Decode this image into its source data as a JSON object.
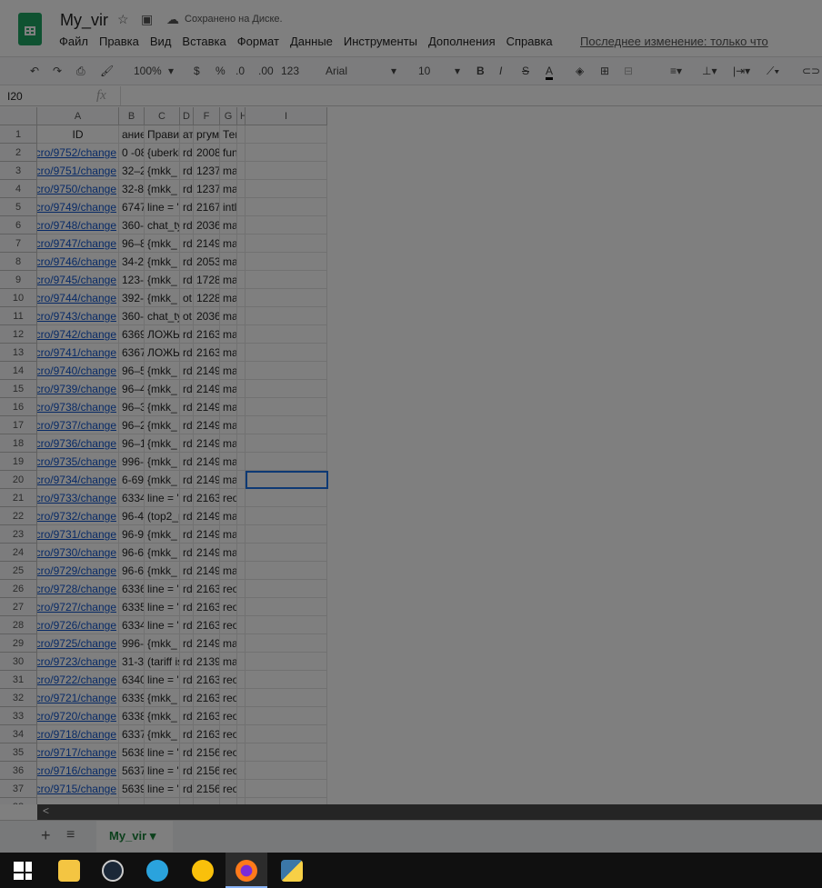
{
  "doc": {
    "title": "My_vir",
    "saved_status": "Сохранено на Диске.",
    "last_edit": "Последнее изменение: только что"
  },
  "menu": [
    "Файл",
    "Правка",
    "Вид",
    "Вставка",
    "Формат",
    "Данные",
    "Инструменты",
    "Дополнения",
    "Справка"
  ],
  "toolbar": {
    "zoom": "100%",
    "currency": "$",
    "percent": "%",
    "dec_less": ".0",
    "dec_more": ".00",
    "format": "123",
    "font": "Arial",
    "font_size": "10",
    "bold": "B",
    "italic": "I",
    "strike": "S",
    "text_color": "A"
  },
  "formula_bar": {
    "cell_ref": "I20",
    "fx": "fx",
    "value": ""
  },
  "columns": [
    "A",
    "B",
    "C",
    "D",
    "F",
    "G",
    "H",
    "I"
  ],
  "header_row": [
    "ID",
    "ание",
    "Правилат",
    "ат",
    "ргуме",
    "Теги",
    "",
    ""
  ],
  "rows": [
    [
      "cro/9752/change/",
      "0 -08",
      "{uberki",
      "rd",
      "2008",
      "fun"
    ],
    [
      "cro/9751/change/",
      "32–2",
      "{mkk_",
      "rd",
      "1237",
      "ma"
    ],
    [
      "cro/9750/change/",
      "32-82",
      "{mkk_",
      "rd",
      "1237",
      "ma"
    ],
    [
      "cro/9749/change/",
      "6747",
      "line = '",
      "rd",
      "2167",
      "intl"
    ],
    [
      "cro/9748/change/",
      "360-8",
      "chat_ty",
      "rd",
      "2036",
      "ma"
    ],
    [
      "cro/9747/change/",
      "96–8",
      "{mkk_",
      "rd",
      "2149",
      "ma"
    ],
    [
      "cro/9746/change/",
      "34-20",
      "{mkk_",
      "rd",
      "2053",
      "ma"
    ],
    [
      "cro/9745/change/",
      "123-3",
      "{mkk_",
      "rd",
      "1728",
      "ma"
    ],
    [
      "cro/9744/change/",
      "392-1",
      "{mkk_",
      "ot",
      "1228",
      "ma"
    ],
    [
      "cro/9743/change/",
      "360-7",
      "chat_ty",
      "ot",
      "2036",
      "ma"
    ],
    [
      "cro/9742/change/",
      "6369",
      "ЛОЖЬ",
      "rd",
      "2163",
      "ma"
    ],
    [
      "cro/9741/change/",
      "6367",
      "ЛОЖЬ",
      "rd",
      "2163",
      "ma"
    ],
    [
      "cro/9740/change/",
      "96–5",
      "{mkk_",
      "rd",
      "2149",
      "ma"
    ],
    [
      "cro/9739/change/",
      "96–4",
      "{mkk_",
      "rd",
      "2149",
      "ma"
    ],
    [
      "cro/9738/change/",
      "96–3",
      "{mkk_",
      "rd",
      "2149",
      "ma"
    ],
    [
      "cro/9737/change/",
      "96–2",
      "{mkk_",
      "rd",
      "2149",
      "ma"
    ],
    [
      "cro/9736/change/",
      "96–1",
      "{mkk_",
      "rd",
      "2149",
      "ma"
    ],
    [
      "cro/9735/change/",
      "996-9",
      "{mkk_",
      "rd",
      "2149",
      "ma"
    ],
    [
      "cro/9734/change/",
      "6-699",
      "{mkk_",
      "rd",
      "2149",
      "ma"
    ],
    [
      "cro/9733/change/",
      "6334",
      "line = '",
      "rd",
      "2163",
      "reo"
    ],
    [
      "cro/9732/change/",
      "96-49",
      "(top2_r",
      "rd",
      "2149",
      "ma"
    ],
    [
      "cro/9731/change/",
      "96-96",
      "{mkk_",
      "rd",
      "2149",
      "ma"
    ],
    [
      "cro/9730/change/",
      "96-69",
      "{mkk_",
      "rd",
      "2149",
      "ma"
    ],
    [
      "cro/9729/change/",
      "96-66",
      "{mkk_",
      "rd",
      "2149",
      "ma"
    ],
    [
      "cro/9728/change/",
      "6336",
      "line = '",
      "rd",
      "2163",
      "reo"
    ],
    [
      "cro/9727/change/",
      "6335",
      "line = '",
      "rd",
      "2163",
      "reo"
    ],
    [
      "cro/9726/change/",
      "6334",
      "line = '",
      "rd",
      "2163",
      "reo"
    ],
    [
      "cro/9725/change/",
      "996-6",
      "{mkk_",
      "rd",
      "2149",
      "ma"
    ],
    [
      "cro/9723/change/",
      "31-31",
      "(tariff is",
      "rd",
      "2139",
      "ma"
    ],
    [
      "cro/9722/change/",
      "6340",
      "line = '",
      "rd",
      "2163",
      "reo"
    ],
    [
      "cro/9721/change/",
      "6339",
      "{mkk_",
      "rd",
      "2163",
      "reo"
    ],
    [
      "cro/9720/change/",
      "6338",
      "{mkk_",
      "rd",
      "2163",
      "reo"
    ],
    [
      "cro/9718/change/",
      "6337",
      "{mkk_",
      "rd",
      "2163",
      "reo"
    ],
    [
      "cro/9717/change/",
      "5638",
      "line = '",
      "rd",
      "2156",
      "reo"
    ],
    [
      "cro/9716/change/",
      "5637",
      "line = '",
      "rd",
      "2156",
      "reo"
    ],
    [
      "cro/9715/change/",
      "5639",
      "line = '",
      "rd",
      "2156",
      "reo"
    ]
  ],
  "sheet_tabs": {
    "add": "+",
    "list": "≡",
    "active": "My_vir"
  },
  "taskbar": [
    "windows-start",
    "file-explorer",
    "steam",
    "telegram",
    "music",
    "firefox",
    "python"
  ]
}
